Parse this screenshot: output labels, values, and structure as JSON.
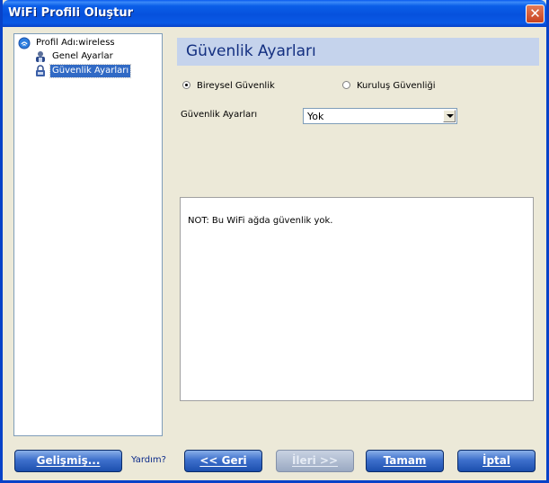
{
  "window": {
    "title": "WiFi Profili Oluştur",
    "close_label": "✕"
  },
  "tree": {
    "root": {
      "label": "Profil Adı:wireless",
      "icon": "wifi-globe-icon"
    },
    "items": [
      {
        "label": "Genel Ayarlar",
        "icon": "users-icon",
        "selected": false
      },
      {
        "label": "Güvenlik Ayarları",
        "icon": "lock-icon",
        "selected": true
      }
    ]
  },
  "main": {
    "header": "Güvenlik Ayarları",
    "radio_personal": "Bireysel Güvenlik",
    "radio_enterprise": "Kuruluş Güvenliği",
    "security_label": "Güvenlik Ayarları",
    "security_value": "Yok",
    "note": "NOT: Bu WiFi ağda güvenlik yok."
  },
  "footer": {
    "advanced": "Gelişmiş...",
    "help": "Yardım?",
    "back": "<< Geri",
    "next": "İleri >>",
    "ok": "Tamam",
    "cancel": "İptal"
  },
  "colors": {
    "title_bar": "#0a5ee8",
    "header_bg": "#c5d3ec",
    "header_text": "#132f80",
    "selected": "#316ac5"
  }
}
